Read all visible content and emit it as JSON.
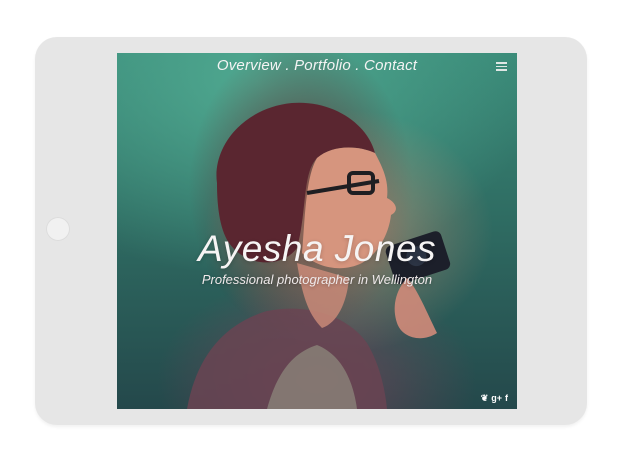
{
  "nav": {
    "items": [
      {
        "label": "Overview"
      },
      {
        "label": "Portfolio"
      },
      {
        "label": "Contact"
      }
    ],
    "separator": "."
  },
  "hero": {
    "name": "Ayesha Jones",
    "subtitle": "Professional photographer in Wellington"
  },
  "menu": {
    "icon": "hamburger-menu-icon"
  },
  "social": {
    "twitter": {
      "icon": "twitter-icon",
      "glyph": "❦"
    },
    "googleplus": {
      "icon": "google-plus-icon",
      "glyph": "g+"
    },
    "facebook": {
      "icon": "facebook-icon",
      "glyph": "f"
    }
  },
  "colors": {
    "device": "#e6e6e6",
    "teal": "#3a8a78",
    "text": "#f4f4f4"
  }
}
